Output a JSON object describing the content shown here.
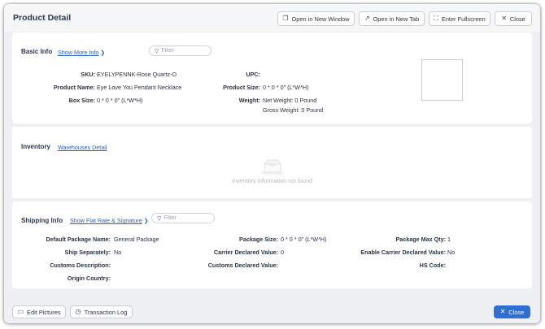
{
  "header": {
    "title": "Product Detail",
    "buttons": {
      "open_new_window": "Open in New Window",
      "open_new_tab": "Open in New Tab",
      "fullscreen": "Enter Fullscreen",
      "close": "Close"
    }
  },
  "basic_info": {
    "title": "Basic Info",
    "show_more": "Show More Info",
    "filter_placeholder": "Filter",
    "sku_label": "SKU:",
    "sku_value": "EYELYPENNK-Rose Quartz-O",
    "product_name_label": "Product Name:",
    "product_name_value": "Eye Love You Pendant Necklace",
    "box_size_label": "Box Size:",
    "box_size_value": "0 * 0 * 0\" (L*W*H)",
    "upc_label": "UPC:",
    "upc_value": "",
    "product_size_label": "Product Size:",
    "product_size_value": "0 * 0 * 0\" (L*W*H)",
    "weight_label": "Weight:",
    "net_weight": "Net Weight: 0 Pound",
    "gross_weight": "Gross Weight: 0 Pound"
  },
  "inventory": {
    "title": "Inventory",
    "warehouses_link": "Warehouses Detail",
    "empty_text": "Inventory information not found"
  },
  "shipping_info": {
    "title": "Shipping Info",
    "show_flat_rate": "Show Flat Rate & Signature",
    "filter_placeholder": "Filter",
    "default_package_label": "Default Package Name:",
    "default_package_value": "General Package",
    "ship_separately_label": "Ship Separately:",
    "ship_separately_value": "No",
    "customs_description_label": "Customs Description:",
    "customs_description_value": "",
    "origin_country_label": "Origin Country:",
    "origin_country_value": "",
    "package_size_label": "Package Size:",
    "package_size_value": "0 * 0 * 0\" (L*W*H)",
    "carrier_declared_label": "Carrier Declared Value:",
    "carrier_declared_value": "0",
    "customs_declared_label": "Customs Declared Value:",
    "customs_declared_value": "",
    "package_max_qty_label": "Package Max Qty:",
    "package_max_qty_value": "1",
    "enable_carrier_label": "Enable Carrier Declared Value:",
    "enable_carrier_value": "No",
    "hs_code_label": "HS Code:",
    "hs_code_value": ""
  },
  "footer": {
    "edit_pictures": "Edit Pictures",
    "transaction_log": "Transaction Log",
    "close": "Close"
  },
  "icons": {
    "window": "window-icon",
    "external": "external-link-icon",
    "fullscreen": "fullscreen-icon",
    "close": "close-icon",
    "filter": "filter-icon",
    "chevron": "chevron-down-icon",
    "empty": "empty-box-icon",
    "picture": "picture-icon",
    "history": "history-icon"
  },
  "colors": {
    "primary": "#2f6fd1",
    "link": "#2560c2",
    "background": "#eef0f3"
  }
}
